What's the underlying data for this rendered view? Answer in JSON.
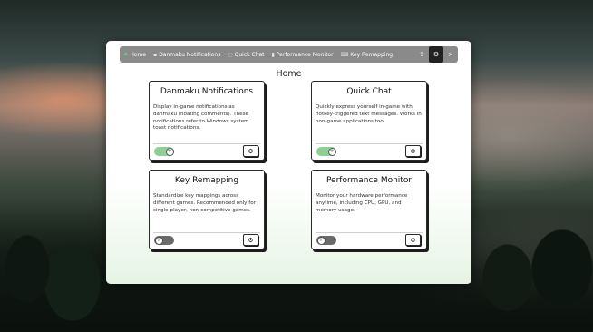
{
  "nav": {
    "items": [
      {
        "icon": "☘",
        "label": "Home"
      },
      {
        "icon": "▪",
        "label": "Danmaku Notifications"
      },
      {
        "icon": "◌",
        "label": "Quick Chat"
      },
      {
        "icon": "▮",
        "label": "Performance Monitor"
      },
      {
        "icon": "⌨",
        "label": "Key Remapping"
      }
    ],
    "extra_icon": "⇪",
    "settings_icon": "⚙",
    "close_icon": "×"
  },
  "page_title": "Home",
  "cards": [
    {
      "title": "Danmaku Notifications",
      "description": "Display in-game notifications as danmaku (floating comments). These notifications refer to Windows system toast notifications.",
      "enabled": true,
      "toggle_icon": "+",
      "gear_icon": "⚙"
    },
    {
      "title": "Quick Chat",
      "description": "Quickly express yourself in-game with hotkey-triggered text messages. Works in non-game applications too.",
      "enabled": true,
      "toggle_icon": "+",
      "gear_icon": "⚙"
    },
    {
      "title": "Key Remapping",
      "description": "Standardize key mappings across different games. Recommended only for single-player, non-competitive games.",
      "enabled": false,
      "toggle_icon": "+",
      "gear_icon": "⚙"
    },
    {
      "title": "Performance Monitor",
      "description": "Monitor your hardware performance anytime, including CPU, GPU, and memory usage.",
      "enabled": false,
      "toggle_icon": "+",
      "gear_icon": "⚙"
    }
  ],
  "colors": {
    "toggle_on": "#8fcf94",
    "toggle_off": "#6a6a6a",
    "navbar": "#8a8a8a",
    "accent_green": "#7ccf8a"
  }
}
